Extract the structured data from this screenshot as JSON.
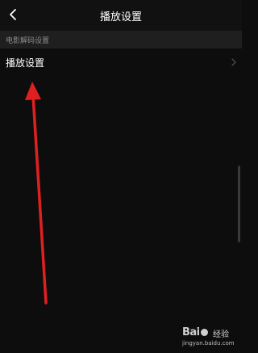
{
  "header": {
    "title": "播放设置",
    "back_icon": "chevron-left-icon"
  },
  "section": {
    "label": "电影解码设置"
  },
  "rows": [
    {
      "label": "播放设置",
      "icon": "chevron-right-icon"
    }
  ],
  "annotation": {
    "color": "#e02020"
  },
  "watermark": {
    "logo_text": "Bai",
    "logo_text_tail": "du",
    "brand": "经验",
    "url": "jingyan.baidu.com"
  }
}
